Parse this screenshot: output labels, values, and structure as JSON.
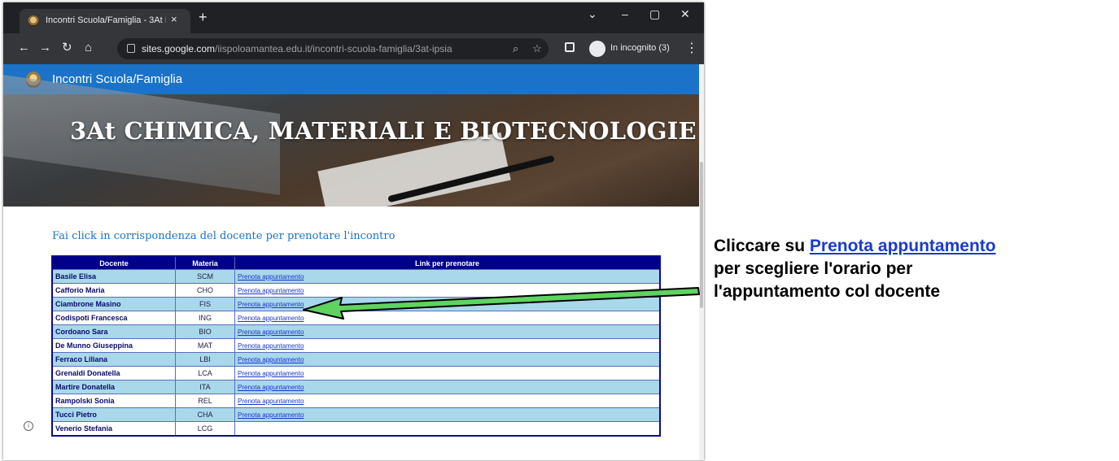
{
  "browser": {
    "tab_title": "Incontri Scuola/Famiglia - 3At IP",
    "tab_close": "×",
    "new_tab": "+",
    "url_domain": "sites.google.com",
    "url_path": "/iispoloamantea.edu.it/incontri-scuola-famiglia/3at-ipsia",
    "incognito_label": "In incognito (3)",
    "icons": [
      "back-icon",
      "forward-icon",
      "reload-icon",
      "home-icon",
      "lock-icon",
      "zoom-icon",
      "star-icon",
      "side-panel-icon",
      "incognito-icon",
      "menu-icon",
      "minimize-icon",
      "maximize-icon",
      "close-icon",
      "chevron-down-icon"
    ]
  },
  "site": {
    "name": "Incontri Scuola/Famiglia",
    "header_color": "#1a73c8",
    "hero_title": "3At CHIMICA, MATERIALI E BIOTECNOLOGIE",
    "instruction": "Fai click in corrispondenza del docente per prenotare l'incontro"
  },
  "table": {
    "headers": [
      "Docente",
      "Materia",
      "Link per prenotare"
    ],
    "header_color": "#00008b",
    "odd_row_color": "#a8d8ea",
    "rows": [
      {
        "docente": "Basile Elisa",
        "materia": "SCM",
        "link": "Prenota appuntamento"
      },
      {
        "docente": "Cafforio Maria",
        "materia": "CHO",
        "link": "Prenota appuntamento"
      },
      {
        "docente": "Ciambrone Masino",
        "materia": "FIS",
        "link": "Prenota appuntamento"
      },
      {
        "docente": "Codispoti Francesca",
        "materia": "ING",
        "link": "Prenota appuntamento"
      },
      {
        "docente": "Cordoano Sara",
        "materia": "BIO",
        "link": "Prenota appuntamento"
      },
      {
        "docente": "De Munno Giuseppina",
        "materia": "MAT",
        "link": "Prenota appuntamento"
      },
      {
        "docente": "Ferraco Liliana",
        "materia": "LBI",
        "link": "Prenota appuntamento"
      },
      {
        "docente": "Grenaldi Donatella",
        "materia": "LCA",
        "link": "Prenota appuntamento"
      },
      {
        "docente": "Martire Donatella",
        "materia": "ITA",
        "link": "Prenota appuntamento"
      },
      {
        "docente": "Rampolski Sonia",
        "materia": "REL",
        "link": "Prenota appuntamento"
      },
      {
        "docente": "Tucci Pietro",
        "materia": "CHA",
        "link": "Prenota appuntamento"
      },
      {
        "docente": "Venerio Stefania",
        "materia": "LCG",
        "link": ""
      }
    ]
  },
  "annotation": {
    "prefix": "Cliccare su ",
    "link": "Prenota appuntamento",
    "line2": "per scegliere l'orario per",
    "line3": "l'appuntamento col docente",
    "arrow_color": "#5fd35f"
  }
}
